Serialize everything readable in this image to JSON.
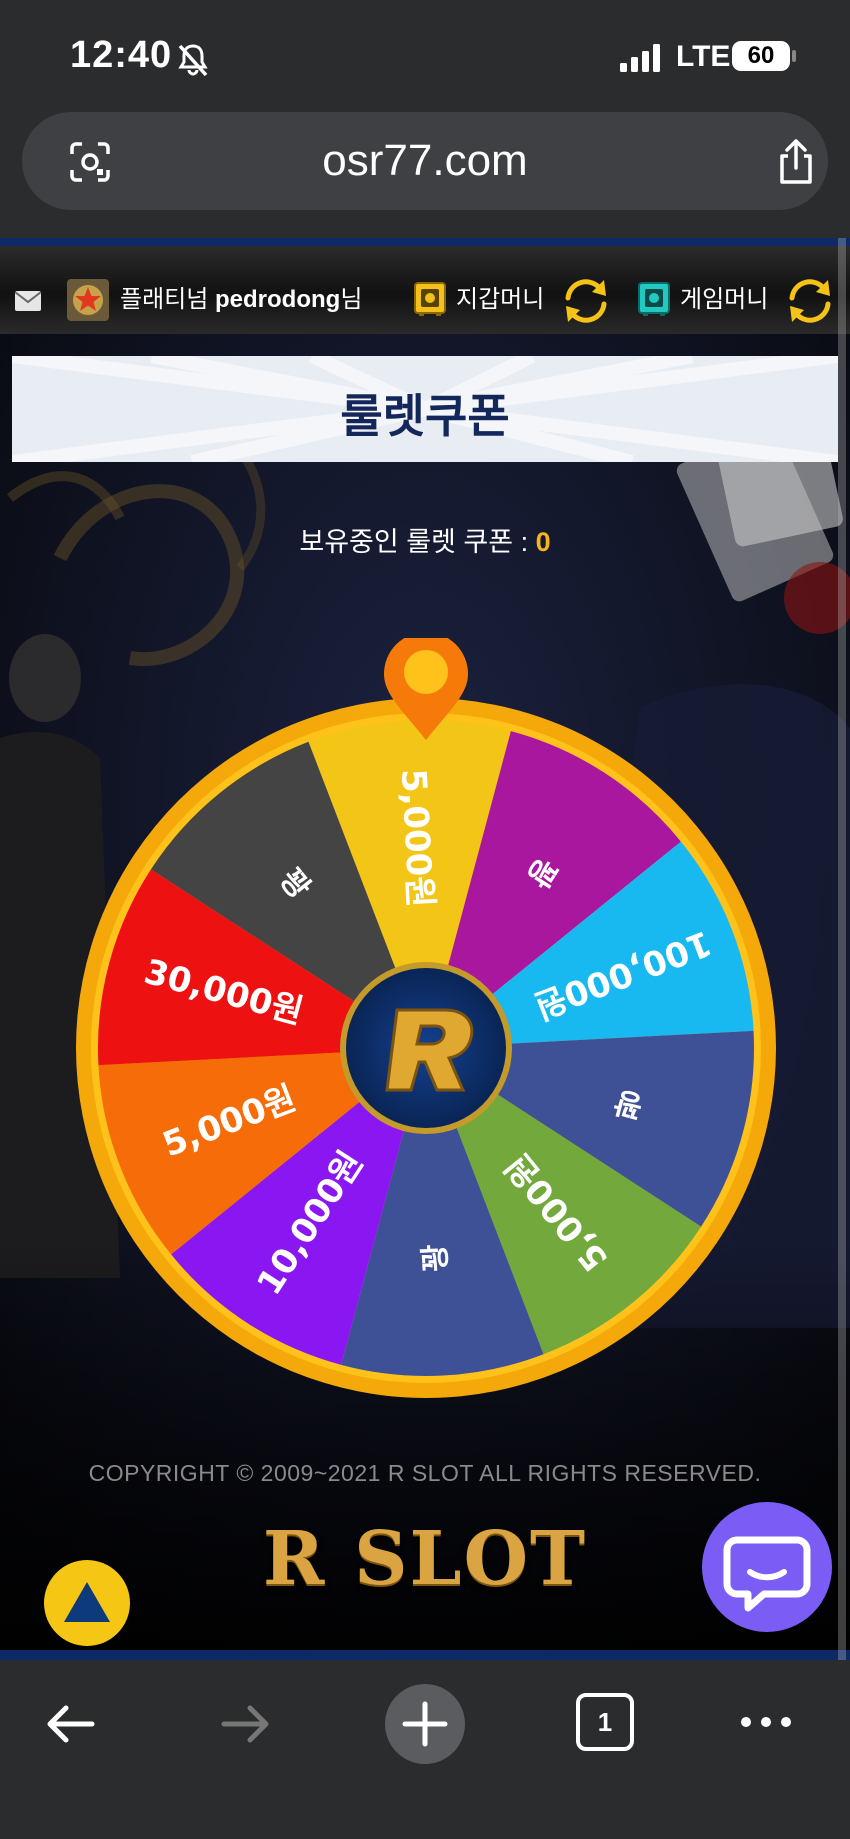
{
  "status_bar": {
    "time": "12:40",
    "network": "LTE",
    "battery": "60"
  },
  "browser": {
    "url": "osr77.com",
    "tab_count": "1"
  },
  "header": {
    "rank": "플래티넘",
    "username": "pedrodong",
    "suffix": "님",
    "wallet_label": "지갑머니",
    "game_label": "게임머니"
  },
  "main": {
    "title": "룰렛쿠폰",
    "coupon_label": "보유중인 룰렛 쿠폰 : ",
    "coupon_count": "0"
  },
  "wheel": {
    "segments": [
      {
        "label": "5,000원",
        "color": "#f2c517"
      },
      {
        "label": "꽝",
        "color": "#a8179e"
      },
      {
        "label": "100,000원",
        "color": "#17b9f0"
      },
      {
        "label": "꽝",
        "color": "#3f5196"
      },
      {
        "label": "5,000원",
        "color": "#72a83c"
      },
      {
        "label": "꽝",
        "color": "#3f5196"
      },
      {
        "label": "10,000원",
        "color": "#8a17f2"
      },
      {
        "label": "5,000원",
        "color": "#f56c08"
      },
      {
        "label": "30,000원",
        "color": "#ee1111"
      },
      {
        "label": "꽝",
        "color": "#444444"
      }
    ]
  },
  "footer": {
    "copyright": "COPYRIGHT © 2009~2021 R SLOT ALL RIGHTS RESERVED.",
    "logo": "R SLOT"
  }
}
